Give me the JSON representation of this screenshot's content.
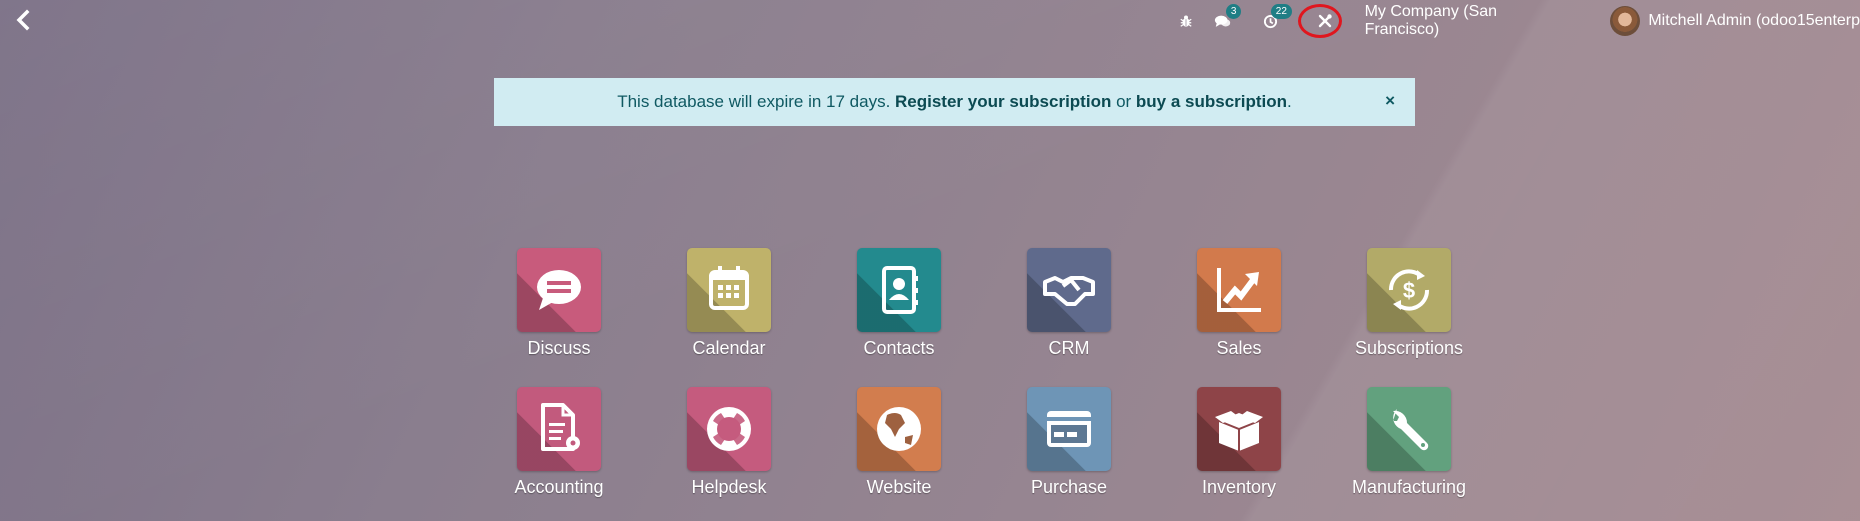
{
  "topbar": {
    "back_icon": "chevron-left-icon",
    "debug_icon": "bug-icon",
    "messages_icon": "comments-icon",
    "messages_count": "3",
    "activities_icon": "clock-icon",
    "activities_count": "22",
    "developer_tools_icon": "tools-icon",
    "company": "My Company (San Francisco)",
    "user": "Mitchell Admin (odoo15enterp"
  },
  "alert": {
    "text_before": "This database will expire in 17 days. ",
    "register_link": "Register your subscription",
    "text_middle": " or ",
    "buy_link": "buy a subscription",
    "text_after": ".",
    "close": "×"
  },
  "apps": [
    {
      "label": "Discuss",
      "icon": "chat-bubble-icon",
      "color": "#c85b7c"
    },
    {
      "label": "Calendar",
      "icon": "calendar-icon",
      "color": "#bfb26a"
    },
    {
      "label": "Contacts",
      "icon": "address-book-icon",
      "color": "#238a8e"
    },
    {
      "label": "CRM",
      "icon": "handshake-icon",
      "color": "#5f6a8c"
    },
    {
      "label": "Sales",
      "icon": "chart-up-icon",
      "color": "#d27a4c"
    },
    {
      "label": "Subscriptions",
      "icon": "dollar-cycle-icon",
      "color": "#b2aa68"
    },
    {
      "label": "Accounting",
      "icon": "document-gear-icon",
      "color": "#c25a7d"
    },
    {
      "label": "Helpdesk",
      "icon": "lifebuoy-icon",
      "color": "#c55b7e"
    },
    {
      "label": "Website",
      "icon": "globe-icon",
      "color": "#d27d4e"
    },
    {
      "label": "Purchase",
      "icon": "credit-card-icon",
      "color": "#6e95b6"
    },
    {
      "label": "Inventory",
      "icon": "box-icon",
      "color": "#8e4448"
    },
    {
      "label": "Manufacturing",
      "icon": "wrench-icon",
      "color": "#62a17e"
    }
  ]
}
